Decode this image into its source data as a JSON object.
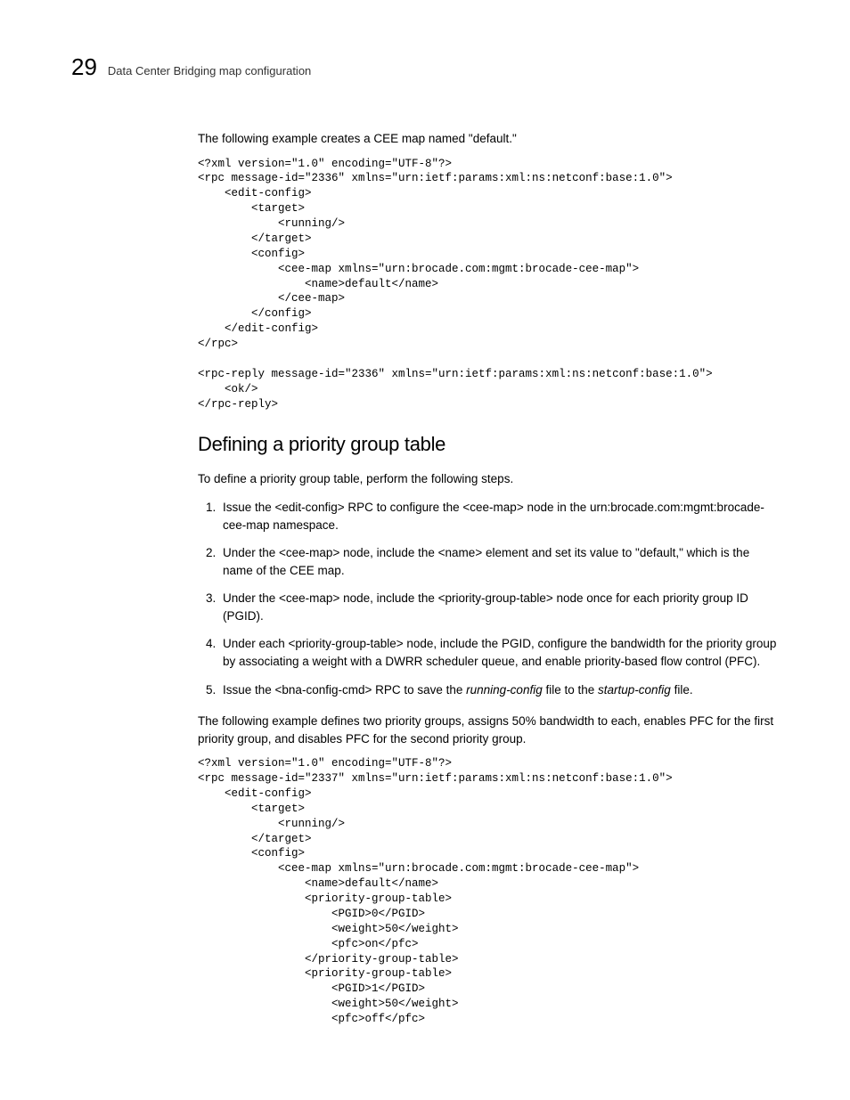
{
  "page_number": "29",
  "header_title": "Data Center Bridging map configuration",
  "intro_text": "The following example creates a CEE map named \"default.\"",
  "code_block_1": "<?xml version=\"1.0\" encoding=\"UTF-8\"?>\n<rpc message-id=\"2336\" xmlns=\"urn:ietf:params:xml:ns:netconf:base:1.0\">\n    <edit-config>\n        <target>\n            <running/>\n        </target>\n        <config>\n            <cee-map xmlns=\"urn:brocade.com:mgmt:brocade-cee-map\">\n                <name>default</name>\n            </cee-map>\n        </config>\n    </edit-config>\n</rpc>\n\n<rpc-reply message-id=\"2336\" xmlns=\"urn:ietf:params:xml:ns:netconf:base:1.0\">\n    <ok/>\n</rpc-reply>",
  "section_heading": "Defining a priority group table",
  "section_intro": "To define a priority group table, perform the following steps.",
  "steps": [
    "Issue the <edit-config> RPC to configure the <cee-map> node in the urn:brocade.com:mgmt:brocade-cee-map namespace.",
    "Under the <cee-map> node, include the <name> element and set its value to \"default,\" which is the name of the CEE map.",
    "Under the <cee-map> node, include the <priority-group-table> node once for each priority group ID (PGID).",
    "Under each <priority-group-table> node, include the PGID, configure the bandwidth for the priority group by associating a weight with a DWRR scheduler queue, and enable priority-based flow control (PFC)."
  ],
  "step5_prefix": "Issue the <bna-config-cmd> RPC to save the ",
  "step5_italic1": "running-config",
  "step5_mid": " file to the ",
  "step5_italic2": "startup-config",
  "step5_suffix": " file.",
  "example_intro": "The following example defines two priority groups, assigns 50% bandwidth to each, enables PFC for the first priority group, and disables PFC for the second priority group.",
  "code_block_2": "<?xml version=\"1.0\" encoding=\"UTF-8\"?>\n<rpc message-id=\"2337\" xmlns=\"urn:ietf:params:xml:ns:netconf:base:1.0\">\n    <edit-config>\n        <target>\n            <running/>\n        </target>\n        <config>\n            <cee-map xmlns=\"urn:brocade.com:mgmt:brocade-cee-map\">\n                <name>default</name>\n                <priority-group-table>\n                    <PGID>0</PGID>\n                    <weight>50</weight>\n                    <pfc>on</pfc>\n                </priority-group-table>\n                <priority-group-table>\n                    <PGID>1</PGID>\n                    <weight>50</weight>\n                    <pfc>off</pfc>"
}
